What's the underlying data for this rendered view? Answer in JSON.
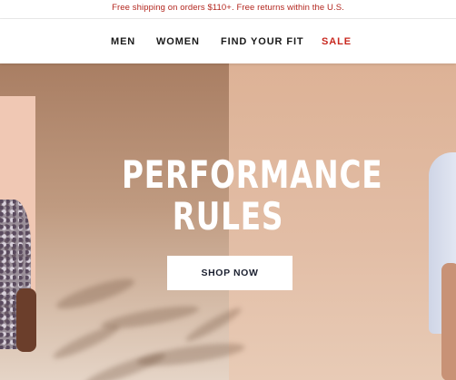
{
  "promo": {
    "text": "Free shipping on orders $110+. Free returns within the U.S.",
    "color": "#b3261e"
  },
  "nav": {
    "items": [
      {
        "label": "MEN"
      },
      {
        "label": "WOMEN"
      },
      {
        "label": "FIND YOUR FIT"
      },
      {
        "label": "SALE",
        "color": "#c8281f"
      }
    ]
  },
  "hero": {
    "title_line1": "PERFORMANCE",
    "title_line2": "RULES",
    "cta_label": "SHOP NOW",
    "background": "#c9a085"
  }
}
